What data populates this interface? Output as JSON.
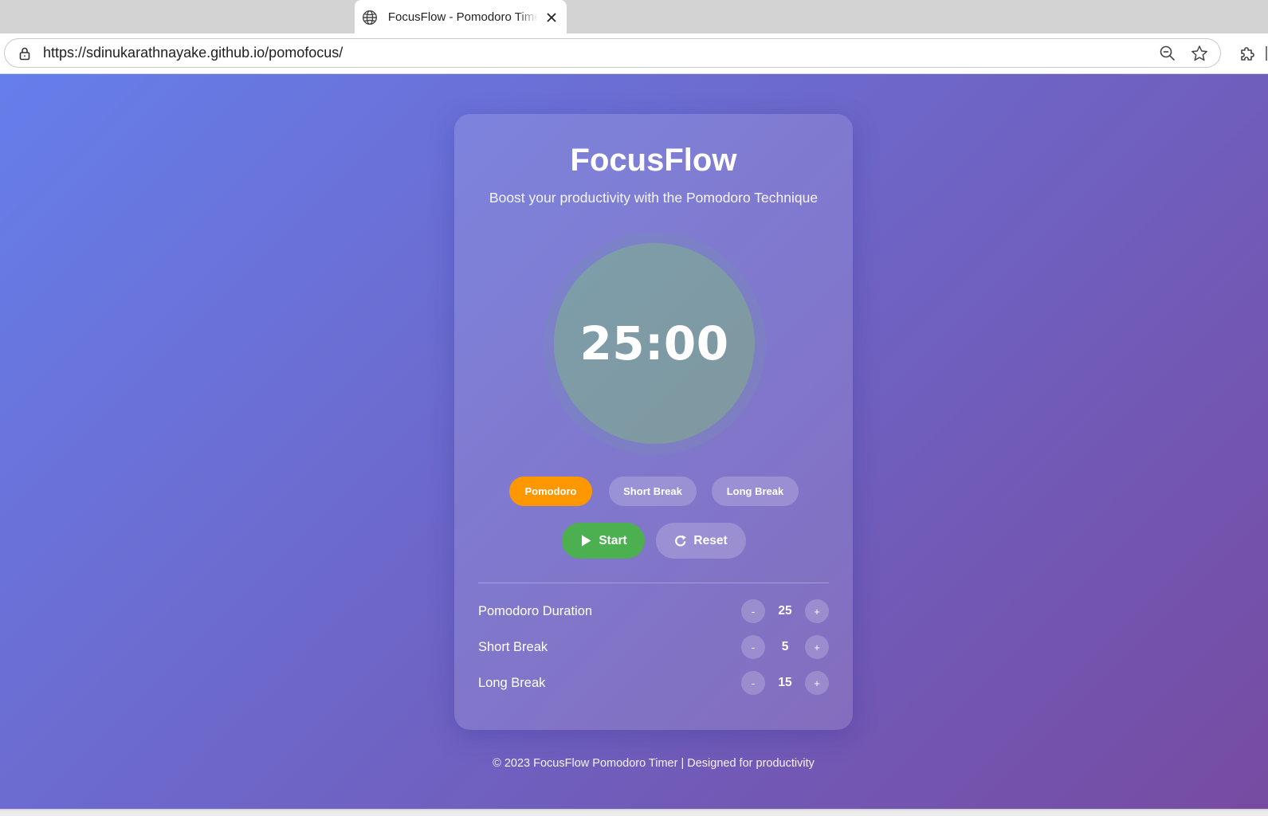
{
  "browser": {
    "tab_title": "FocusFlow - Pomodoro Timer",
    "url": "https://sdinukarathnayake.github.io/pomofocus/"
  },
  "app": {
    "title": "FocusFlow",
    "subtitle": "Boost your productivity with the Pomodoro Technique",
    "timer": "25:00",
    "modes": [
      {
        "label": "Pomodoro",
        "active": true
      },
      {
        "label": "Short Break",
        "active": false
      },
      {
        "label": "Long Break",
        "active": false
      }
    ],
    "actions": {
      "start_label": "Start",
      "reset_label": "Reset"
    },
    "settings": [
      {
        "label": "Pomodoro Duration",
        "value": "25",
        "minus": "-",
        "plus": "+"
      },
      {
        "label": "Short Break",
        "value": "5",
        "minus": "-",
        "plus": "+"
      },
      {
        "label": "Long Break",
        "value": "15",
        "minus": "-",
        "plus": "+"
      }
    ],
    "footer": "© 2023 FocusFlow Pomodoro Timer | Designed for productivity"
  },
  "colors": {
    "gradient_start": "#667eea",
    "gradient_end": "#764ba2",
    "active_mode": "#ff9800",
    "start_button": "#4caf50"
  },
  "icons": {
    "tab_favicon": "globe-icon",
    "tab_close": "close-icon",
    "address_lock": "lock-icon",
    "zoom": "zoom-out-icon",
    "bookmark": "star-icon",
    "extensions": "puzzle-icon",
    "start": "play-icon",
    "reset": "redo-icon"
  }
}
